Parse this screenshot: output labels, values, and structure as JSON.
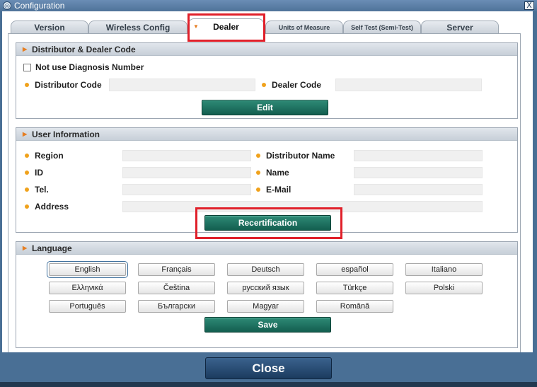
{
  "window": {
    "title": "Configuration",
    "close_glyph": "X"
  },
  "tabs": [
    {
      "label": "Version"
    },
    {
      "label": "Wireless Config"
    },
    {
      "label": "Dealer",
      "active": true
    },
    {
      "label": "Units of Measure"
    },
    {
      "label": "Self Test (Semi-Test)"
    },
    {
      "label": "Server"
    }
  ],
  "distributor_panel": {
    "title": "Distributor & Dealer Code",
    "checkbox_label": "Not use Diagnosis Number",
    "checkbox_checked": false,
    "distributor_code_label": "Distributor Code",
    "distributor_code_value": "",
    "dealer_code_label": "Dealer Code",
    "dealer_code_value": "",
    "edit_label": "Edit"
  },
  "user_panel": {
    "title": "User Information",
    "region_label": "Region",
    "region_value": "",
    "id_label": "ID",
    "id_value": "",
    "tel_label": "Tel.",
    "tel_value": "",
    "address_label": "Address",
    "address_value": "",
    "distributor_name_label": "Distributor Name",
    "distributor_name_value": "",
    "name_label": "Name",
    "name_value": "",
    "email_label": "E-Mail",
    "email_value": "",
    "recertification_label": "Recertification"
  },
  "language_panel": {
    "title": "Language",
    "languages": [
      "English",
      "Français",
      "Deutsch",
      "español",
      "Italiano",
      "Ελληνικά",
      "Čeština",
      "русский язык",
      "Türkçe",
      "Polski",
      "Português",
      "Български",
      "Magyar",
      "Română"
    ],
    "selected": "English",
    "save_label": "Save"
  },
  "footer": {
    "close_label": "Close"
  },
  "colors": {
    "accent_green": "#1f6f5f",
    "highlight_red": "#e0202a",
    "bullet_orange": "#f0a21c"
  },
  "icons": {
    "tab_arrow": "orange-triangle-icon",
    "section_arrow": "orange-triangle-icon",
    "field_bullet": "orange-dot-icon"
  }
}
